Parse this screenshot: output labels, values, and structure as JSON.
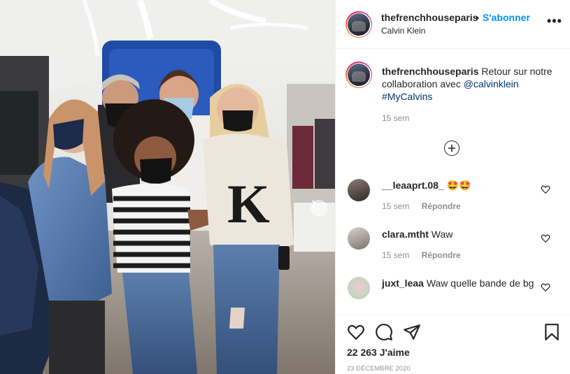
{
  "post": {
    "username": "thefrenchhouseparis",
    "dot": "•",
    "follow_label": "S'abonner",
    "location": "Calvin Klein",
    "more_label": "•••",
    "photo_alt": "Photo"
  },
  "caption": {
    "username": "thefrenchhouseparis",
    "text_before": " Retour sur notre collaboration avec ",
    "mention": "@calvinklein",
    "hashtag": "#MyCalvins",
    "time": "15 sem"
  },
  "comments": [
    {
      "username": "__leaaprt.08_",
      "text": " 🤩🤩",
      "time": "15 sem",
      "reply_label": "Répondre"
    },
    {
      "username": "clara.mtht",
      "text": " Waw",
      "time": "15 sem",
      "reply_label": "Répondre"
    },
    {
      "username": "juxt_leaa",
      "text": " Waw quelle bande de bg"
    }
  ],
  "engagement": {
    "likes": "22 263 J'aime",
    "date": "23 DÉCEMBRE 2020"
  },
  "colors": {
    "accent": "#0095f6",
    "link": "#00376b",
    "muted": "#8e8e8e",
    "text": "#262626"
  },
  "icons": [
    "more-icon",
    "add-circle-icon",
    "heart-icon",
    "comment-icon",
    "share-icon",
    "bookmark-icon",
    "chevron-right-icon"
  ]
}
